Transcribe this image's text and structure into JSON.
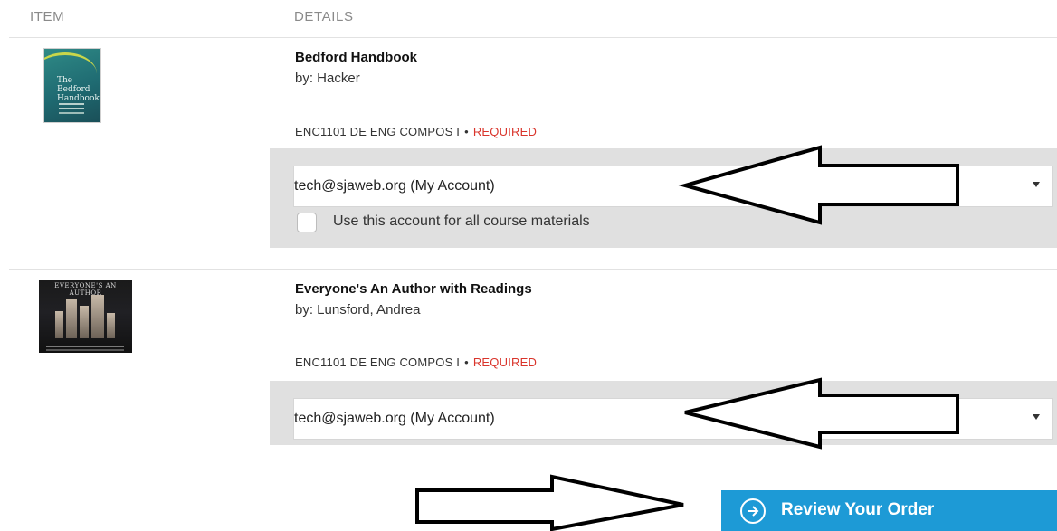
{
  "header": {
    "item_label": "ITEM",
    "details_label": "DETAILS"
  },
  "items": [
    {
      "title": "Bedford Handbook",
      "author": "by: Hacker",
      "course": "ENC1101 DE ENG COMPOS I",
      "requirement": "REQUIRED",
      "account_select_value": "tech@sjaweb.org (My Account)",
      "checkbox_label": "Use this account for all course materials",
      "cover_lettering": "The Bedford Handbook"
    },
    {
      "title": "Everyone's An Author with Readings",
      "author": "by: Lunsford, Andrea",
      "course": "ENC1101 DE ENG COMPOS I",
      "requirement": "REQUIRED",
      "account_select_value": "tech@sjaweb.org (My Account)",
      "cover_lettering": "EVERYONE'S AN AUTHOR"
    }
  ],
  "review_button_label": "Review Your Order",
  "colors": {
    "accent": "#1d9ad6",
    "required": "#d9342b",
    "panel": "#e0e0e0"
  },
  "icons": [
    "arrow-right-circle-icon",
    "chevron-down-icon",
    "annotation-arrow-left-icon",
    "annotation-arrow-right-icon"
  ]
}
